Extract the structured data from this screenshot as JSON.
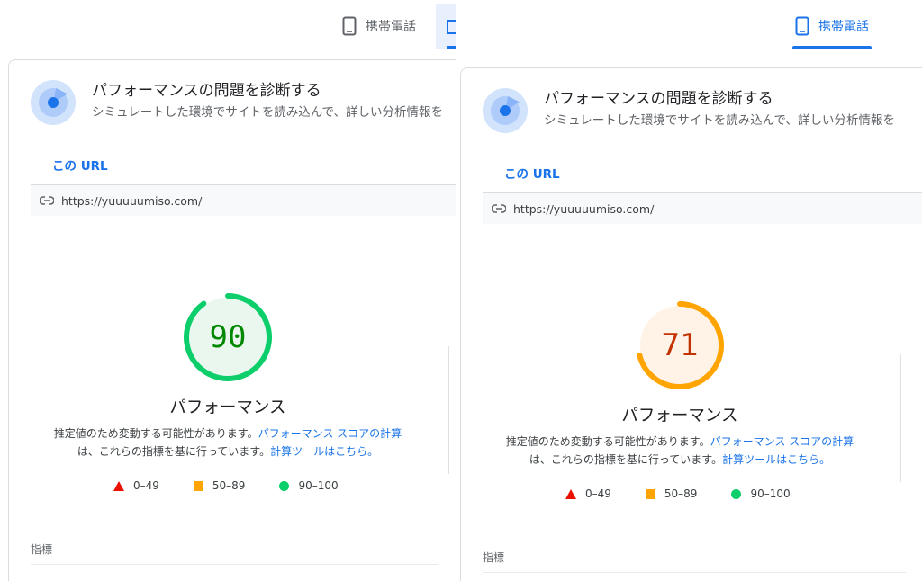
{
  "colors": {
    "accent": "#1a73e8",
    "pass": "#0cce6b",
    "pass_text": "#008800",
    "average": "#ffa400",
    "average_text": "#c33300",
    "fail": "#eb0f00"
  },
  "device_tabs": {
    "mobile_label": "携帯電話",
    "icon": "smartphone-icon"
  },
  "card": {
    "title": "パフォーマンスの問題を診断する",
    "subtitle": "シミュレートした環境でサイトを読み込んで、詳しい分析情報を",
    "url_tab_label": "この URL",
    "url": "https://yuuuuumiso.com/",
    "link_icon": "link-icon",
    "category_label": "パフォーマンス",
    "note_prefix": "推定値のため変動する可能性があります。",
    "note_link_1": "パフォーマンス スコアの計算",
    "note_middle": "は、これらの指標を基に行っています。",
    "note_link_2": "計算ツールはこちら。",
    "metrics_label": "指標"
  },
  "legend": [
    {
      "shape": "triangle",
      "label": "0–49"
    },
    {
      "shape": "square",
      "label": "50–89"
    },
    {
      "shape": "circle",
      "label": "90–100"
    }
  ],
  "left": {
    "score": "90",
    "score_value": 90
  },
  "right": {
    "score": "71",
    "score_value": 71
  }
}
